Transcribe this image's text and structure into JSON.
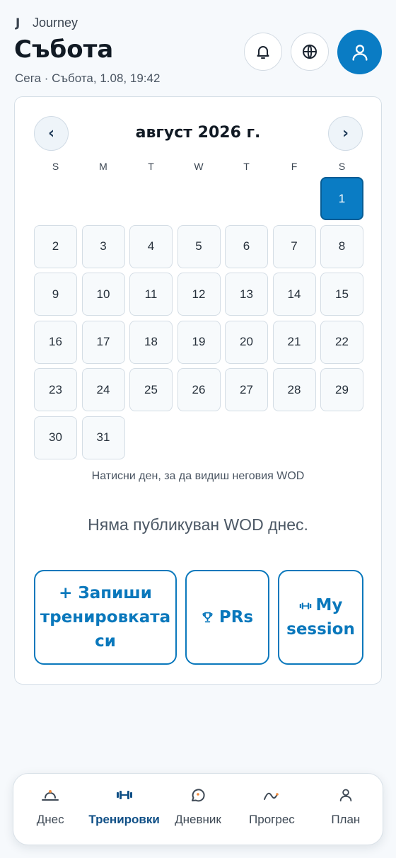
{
  "header": {
    "brand": "Journey",
    "title": "Събота",
    "now_line": "Сега · Събота, 1.08, 19:42"
  },
  "calendar": {
    "month_title": "август 2026 г.",
    "prev_label": "‹",
    "next_label": "›",
    "weekdays": [
      "S",
      "M",
      "T",
      "W",
      "T",
      "F",
      "S"
    ],
    "leading_blanks": 6,
    "days": [
      "1",
      "2",
      "3",
      "4",
      "5",
      "6",
      "7",
      "8",
      "9",
      "10",
      "11",
      "12",
      "13",
      "14",
      "15",
      "16",
      "17",
      "18",
      "19",
      "20",
      "21",
      "22",
      "23",
      "24",
      "25",
      "26",
      "27",
      "28",
      "29",
      "30",
      "31"
    ],
    "selected_day": "1",
    "hint": "Натисни ден, за да видиш неговия WOD",
    "no_wod": "Няма публикуван WOD днес."
  },
  "actions": {
    "log_label": "+ Запиши тренировката си",
    "prs_label": "PRs",
    "session_label": "My session"
  },
  "tabs": [
    {
      "label": "Днес",
      "icon": "sunrise-icon",
      "active": false
    },
    {
      "label": "Тренировки",
      "icon": "dumbbell-icon",
      "active": true
    },
    {
      "label": "Дневник",
      "icon": "chat-bubble-icon",
      "active": false
    },
    {
      "label": "Прогрес",
      "icon": "trend-line-icon",
      "active": false
    },
    {
      "label": "План",
      "icon": "user-icon",
      "active": false
    }
  ],
  "colors": {
    "accent": "#0a7cc4",
    "active_tab": "#0f4f86",
    "icon_orange": "#f08a3c"
  }
}
